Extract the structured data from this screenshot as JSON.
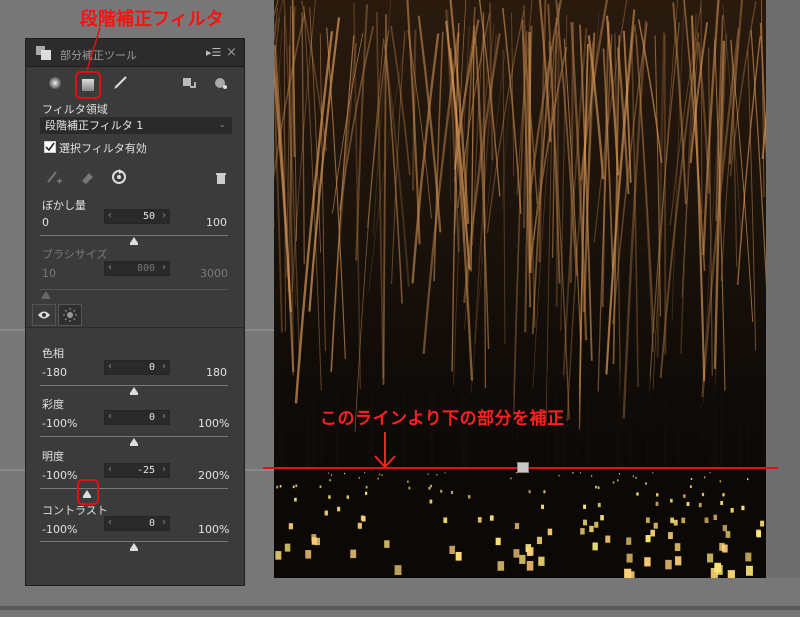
{
  "annotations": {
    "top_label": "段階補正フィルタ",
    "guide_label": "このラインより下の部分を補正"
  },
  "panel": {
    "title": "部分補正ツール",
    "menu_icon": "▸☰",
    "close_icon": "×",
    "filter_area_label": "フィルタ領域",
    "filter_area_value": "段階補正フィルタ 1",
    "filter_enable_label": "選択フィルタ有効",
    "filter_enabled": true,
    "blur": {
      "label": "ぼかし量",
      "value": "50",
      "min": "0",
      "max": "100",
      "level": 0.5
    },
    "brush_size": {
      "label": "ブラシサイズ",
      "value": "800",
      "min": "10",
      "max": "3000",
      "level": 0.03
    },
    "hue": {
      "label": "色相",
      "value": "0",
      "min": "-180",
      "max": "180",
      "level": 0.5
    },
    "saturation": {
      "label": "彩度",
      "value": "0",
      "min": "-100%",
      "max": "100%",
      "level": 0.5
    },
    "brightness": {
      "label": "明度",
      "value": "-25",
      "min": "-100%",
      "max": "200%",
      "level": 0.25
    },
    "contrast": {
      "label": "コントラスト",
      "value": "0",
      "min": "-100%",
      "max": "100%",
      "level": 0.5
    }
  },
  "colors": {
    "annotation_red": "#e01010",
    "panel_bg": "#3b3b3b"
  },
  "icons": [
    "circle-brush-icon",
    "gradient-filter-icon",
    "brush-icon",
    "undo-icon",
    "redo-icon",
    "add-brush-icon",
    "eraser-icon",
    "reset-icon",
    "trash-icon",
    "color-tab-icon",
    "light-tab-icon"
  ]
}
